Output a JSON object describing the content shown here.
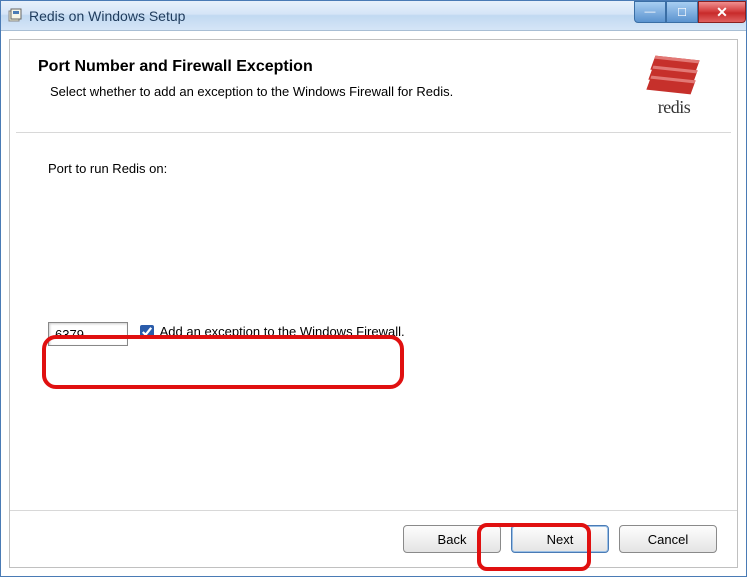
{
  "window": {
    "title": "Redis on Windows Setup"
  },
  "header": {
    "title": "Port Number and Firewall Exception",
    "subtitle": "Select whether to add an exception to the Windows Firewall for Redis."
  },
  "logo": {
    "text": "redis",
    "icon_name": "redis-logo-icon"
  },
  "form": {
    "port_label": "Port to run Redis on:",
    "port_value": "6379",
    "firewall_checkbox_label": "Add an exception to the Windows Firewall.",
    "firewall_checked": true
  },
  "buttons": {
    "back": "Back",
    "next": "Next",
    "cancel": "Cancel"
  },
  "window_controls": {
    "minimize": "—",
    "maximize": "☐",
    "close": "✕"
  }
}
